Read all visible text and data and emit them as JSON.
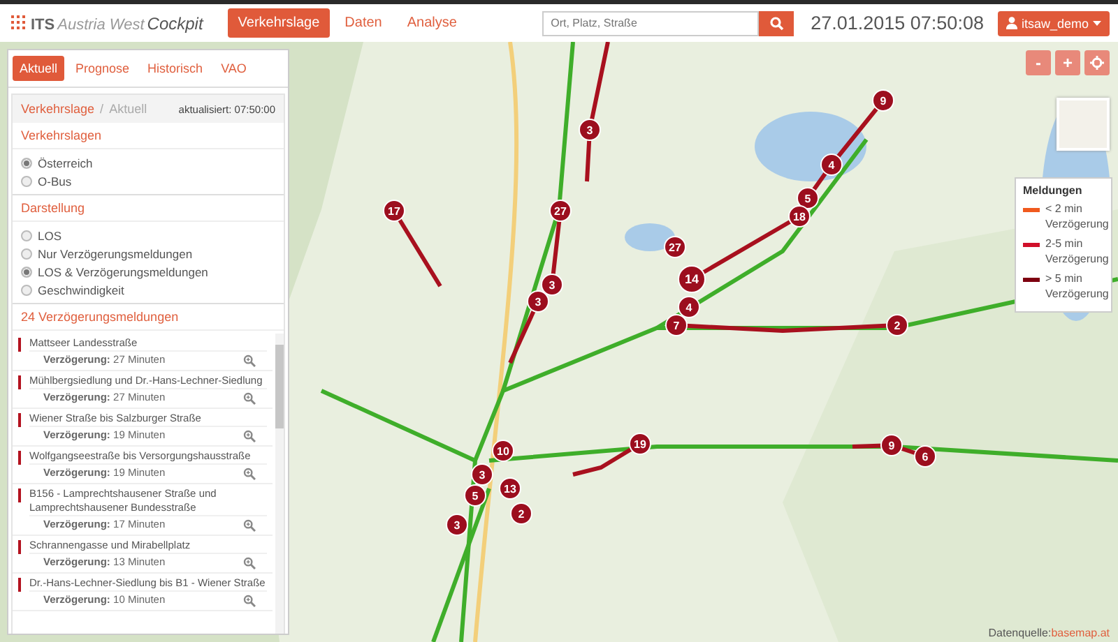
{
  "header": {
    "logo": {
      "brand": "ITS",
      "region": "Austria West",
      "product": "Cockpit"
    },
    "nav": [
      {
        "label": "Verkehrslage",
        "selected": true
      },
      {
        "label": "Daten",
        "selected": false
      },
      {
        "label": "Analyse",
        "selected": false
      }
    ],
    "search": {
      "placeholder": "Ort, Platz, Straße"
    },
    "datetime": "27.01.2015 07:50:08",
    "user": "itsaw_demo"
  },
  "panel": {
    "tabs": [
      {
        "label": "Aktuell",
        "selected": true
      },
      {
        "label": "Prognose",
        "selected": false
      },
      {
        "label": "Historisch",
        "selected": false
      },
      {
        "label": "VAO",
        "selected": false
      }
    ],
    "breadcrumb": [
      "Verkehrslage",
      "/",
      "Aktuell"
    ],
    "updated": "aktualisiert: 07:50:00",
    "sections": [
      {
        "title": "Verkehrslagen",
        "options": [
          {
            "label": "Österreich",
            "selected": true
          },
          {
            "label": "O-Bus",
            "selected": false
          }
        ]
      },
      {
        "title": "Darstellung",
        "options": [
          {
            "label": "LOS",
            "selected": false
          },
          {
            "label": "Nur Verzögerungsmeldungen",
            "selected": false
          },
          {
            "label": "LOS & Verzögerungsmeldungen",
            "selected": true
          },
          {
            "label": "Geschwindigkeit",
            "selected": false
          }
        ]
      }
    ],
    "messages_title": "24 Verzögerungsmeldungen",
    "messages": [
      {
        "title": "Mattseer Landesstraße",
        "delay": "**Verzögerung:** 27 Minuten",
        "color": "#b3121f"
      },
      {
        "title": "Mühlbergsiedlung und Dr.-Hans-Lechner-Siedlung",
        "delay": "**Verzögerung:** 27 Minuten",
        "color": "#b3121f"
      },
      {
        "title": "Wiener Straße bis Salzburger Straße",
        "delay": "**Verzögerung:** 19 Minuten",
        "color": "#b3121f"
      },
      {
        "title": "Wolfgangseestraße bis Versorgungshausstraße",
        "delay": "**Verzögerung:** 19 Minuten",
        "color": "#b3121f"
      },
      {
        "title": "B156 - Lamprechtshausener Straße und Lamprechtshausener Bundesstraße",
        "delay": "**Verzögerung:** 17 Minuten",
        "color": "#b3121f"
      },
      {
        "title": "Schrannengasse und Mirabellplatz",
        "delay": "**Verzögerung:** 13 Minuten",
        "color": "#b3121f"
      },
      {
        "title": "Dr.-Hans-Lechner-Siedlung bis B1 - Wiener Straße",
        "delay": "**Verzögerung:** 10 Minuten",
        "color": "#b3121f"
      }
    ]
  },
  "map": {
    "zoom_controls": [
      {
        "kind": "minus",
        "label": "-"
      },
      {
        "kind": "plus",
        "label": "+"
      },
      {
        "kind": "locate"
      }
    ],
    "markers": [
      "9",
      "4",
      "5",
      "18",
      "27",
      "14",
      "4",
      "7",
      "2",
      "3",
      "27",
      "17",
      "3",
      "3",
      "19",
      "10",
      "3",
      "13",
      "5",
      "2",
      "3",
      "9",
      "6"
    ],
    "legend": {
      "title": "Meldungen",
      "items": [
        {
          "label": "< 2 min Verzögerung",
          "color": "#f05a1e"
        },
        {
          "label": "2-5 min Verzögerung",
          "color": "#d0102a"
        },
        {
          "label": "> 5 min Verzögerung",
          "color": "#7e0010"
        }
      ]
    },
    "attribution": {
      "label": "Datenquelle:",
      "link": "basemap.at"
    }
  }
}
